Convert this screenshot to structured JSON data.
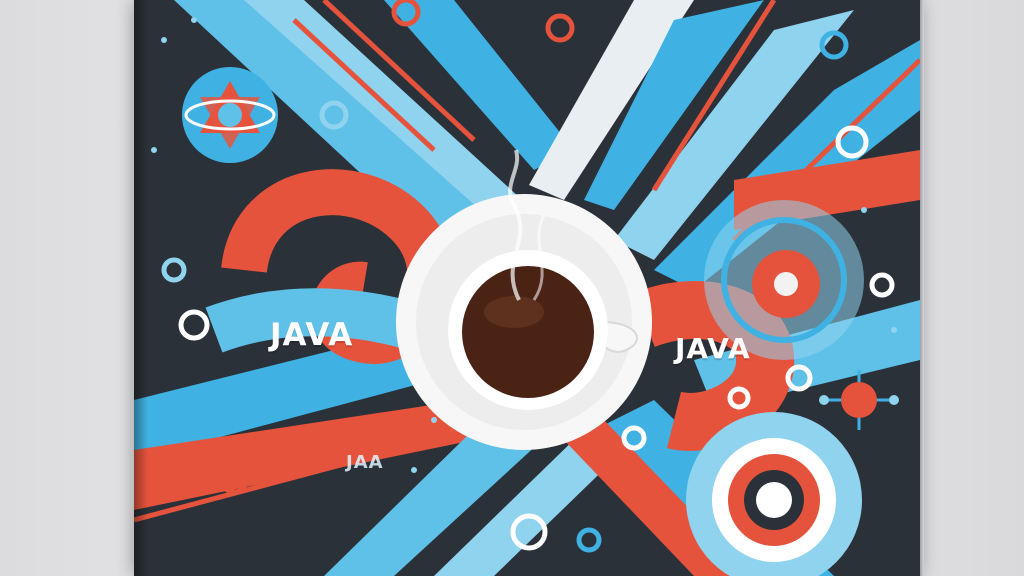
{
  "scene": {
    "labels": {
      "left_ribbon": "JAVA",
      "right_ribbon": "JAVA",
      "lower_ribbon": "JAA"
    },
    "colors": {
      "background_wall": "#e4e5e7",
      "book_dark": "#2b3138",
      "accent_blue": "#3fb2e3",
      "accent_light_blue": "#8fd3ef",
      "accent_red": "#e6533c",
      "coffee": "#4a2315",
      "cup_white": "#f7f7f7"
    },
    "icons": [
      "coffee-cup-icon",
      "atom-icon",
      "gear-icon",
      "target-ring-icon"
    ]
  }
}
